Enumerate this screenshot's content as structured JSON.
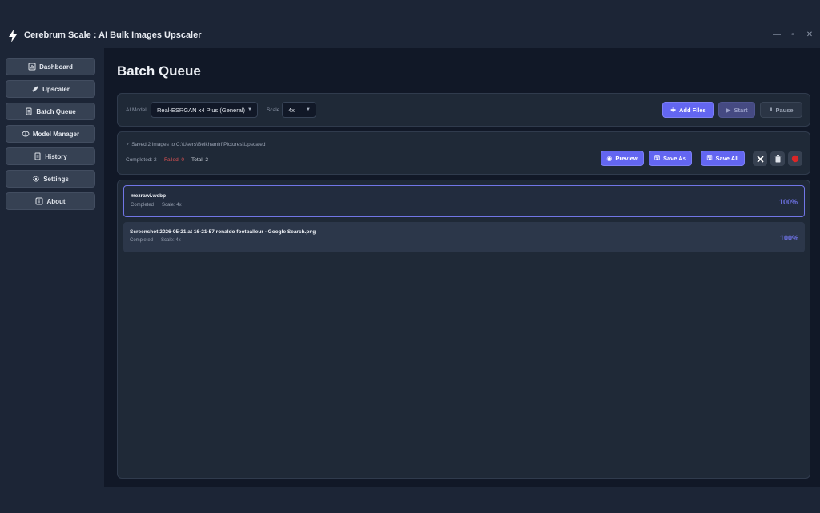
{
  "app": {
    "title": "Cerebrum Scale : AI Bulk Images Upscaler",
    "window_controls": [
      "—",
      "▫",
      "✕"
    ]
  },
  "sidebar": {
    "items": [
      {
        "label": "Dashboard",
        "icon": "dashboard-icon"
      },
      {
        "label": "Upscaler",
        "icon": "rocket-icon"
      },
      {
        "label": "Batch Queue",
        "icon": "queue-icon"
      },
      {
        "label": "Model Manager",
        "icon": "brain-icon"
      },
      {
        "label": "History",
        "icon": "history-icon"
      },
      {
        "label": "Settings",
        "icon": "gear-icon"
      },
      {
        "label": "About",
        "icon": "info-icon"
      }
    ]
  },
  "page": {
    "title": "Batch Queue"
  },
  "toolbar": {
    "model_label": "AI Model",
    "model_value": "Real-ESRGAN x4 Plus (General)",
    "scale_label": "Scale",
    "scale_value": "4x",
    "add_files": "Add Files",
    "start": "Start",
    "pause": "Pause"
  },
  "status": {
    "message": "✓ Saved 2 images to C:\\Users\\Belkhamiri\\Pictures\\Upscaled",
    "completed": "Completed: 2",
    "failed": "Failed: 0",
    "total": "Total: 2",
    "preview": "Preview",
    "save_as": "Save As",
    "save_all": "Save All"
  },
  "queue": [
    {
      "name": "mezrawi.webp",
      "status": "Completed",
      "scale": "Scale: 4x",
      "progress": "100%",
      "selected": true
    },
    {
      "name": "Screenshot 2026-05-21 at 16-21-57 ronaldo footballeur - Google Search.png",
      "status": "Completed",
      "scale": "Scale: 4x",
      "progress": "100%",
      "selected": false
    }
  ],
  "colors": {
    "accent": "#6366f1",
    "background": "#111827",
    "sidebar": "#1c2536",
    "failed": "#e05252",
    "danger": "#dc2626"
  }
}
